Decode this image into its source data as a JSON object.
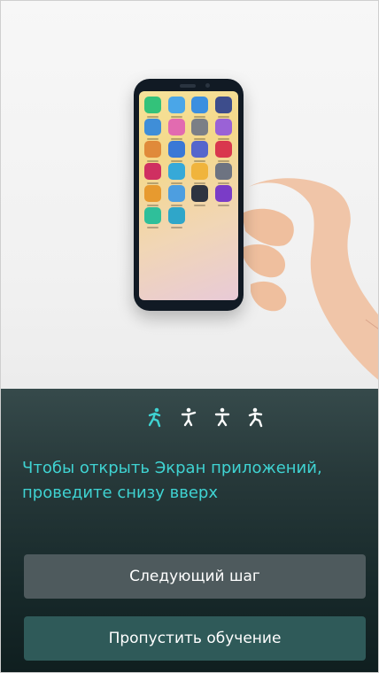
{
  "tutorial": {
    "hint_text": "Чтобы открыть Экран приложений, проведите снизу вверх",
    "step_indicator": [
      "walking-figure-icon",
      "standing-figure-icon",
      "standing-figure-icon",
      "walking-figure-icon"
    ],
    "active_step": 1,
    "next_step_label": "Следующий шаг",
    "skip_label": "Пропустить обучение"
  },
  "colors": {
    "accent": "#3fd3d2",
    "panel_top": "#364a4b",
    "panel_bottom": "#0f1e1f",
    "button_next": "#4e5a5d",
    "button_skip": "#2f5a59"
  }
}
